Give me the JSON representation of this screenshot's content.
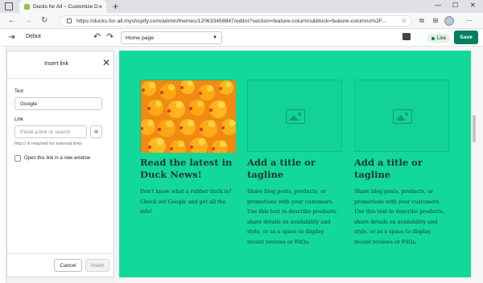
{
  "browser": {
    "tab_title": "Ducks for All ~ Customize Debut",
    "tab_close": "×",
    "new_tab": "+",
    "back": "←",
    "forward": "→",
    "refresh": "↻",
    "url": "https://ducks-for-all.myshopify.com/admin/themes/120633458847/editor?section=feature-columns&block=feature-columns%2F...",
    "window_controls": [
      "—",
      "☐",
      "✕"
    ]
  },
  "editor": {
    "theme_name": "Debut",
    "undo": "↶",
    "redo": "↷",
    "page_select": "Home page",
    "live_label": "Live",
    "save_label": "Save"
  },
  "link_panel": {
    "title": "Insert link",
    "close": "✕",
    "text_label": "Text",
    "text_value": "Google",
    "link_label": "Link",
    "link_placeholder": "Paste a link or search",
    "clear_glyph": "⊗",
    "help_text": "http:// is required for external links",
    "new_window_label": "Open this link in a new window",
    "new_window_checked": false,
    "cancel_label": "Cancel",
    "insert_label": "Insert"
  },
  "preview": {
    "background": "#12d99a",
    "columns": [
      {
        "image": "rubber-ducks-photo",
        "heading": "Read the latest in Duck News!",
        "text": "Don't know what a rubber duck is? Check out Google and get all the info!"
      },
      {
        "image": "image-placeholder",
        "heading": "Add a title or tagline",
        "text": "Share blog posts, products, or promotions with your customers. Use this text to describe products, share details on availability and style, or as a space to display recent reviews or FAQs."
      },
      {
        "image": "image-placeholder",
        "heading": "Add a title or tagline",
        "text": "Share blog posts, products, or promotions with your customers. Use this text to describe products, share details on availability and style, or as a space to display recent reviews or FAQs."
      }
    ]
  },
  "colors": {
    "brand_green": "#008060",
    "preview_green": "#12d99a",
    "heading_text": "#17362b"
  }
}
